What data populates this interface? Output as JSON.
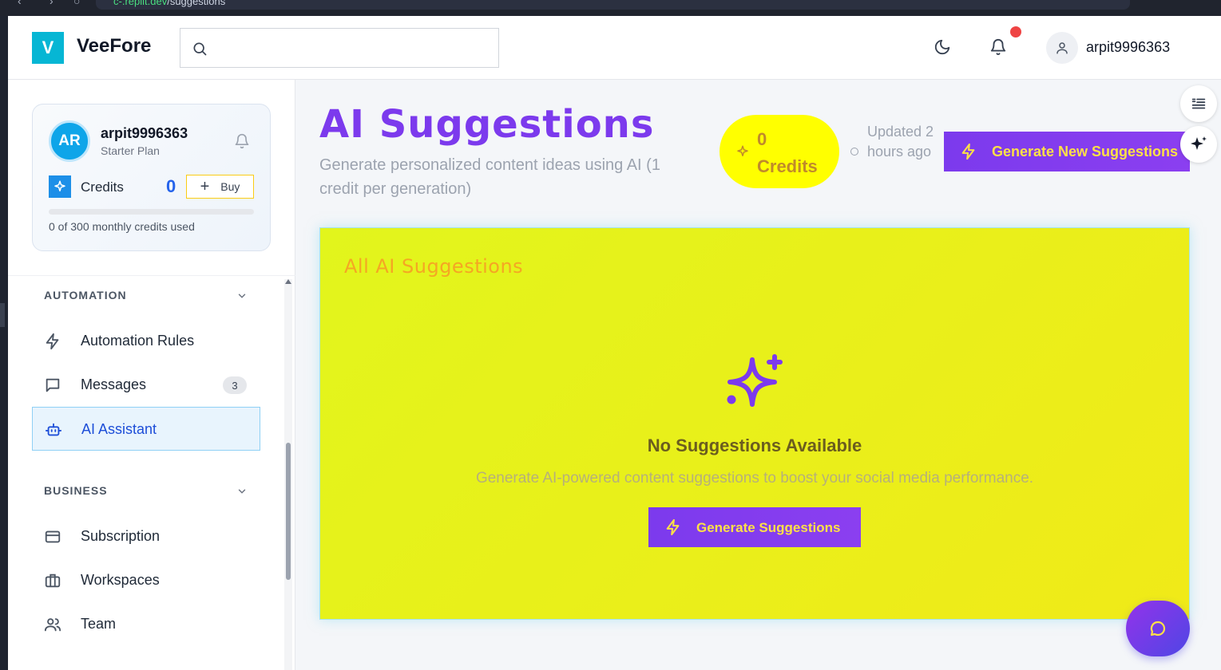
{
  "browser": {
    "url_domain": "c-.replit.dev",
    "url_path": "/suggestions"
  },
  "topbar": {
    "logo_letter": "V",
    "brand": "VeeFore",
    "search_placeholder": "",
    "user_name": "arpit9996363"
  },
  "sidebar": {
    "profile": {
      "initials": "AR",
      "name": "arpit9996363",
      "plan": "Starter Plan",
      "credits_label": "Credits",
      "credits_value": "0",
      "buy_label": "Buy",
      "usage_text": "0 of 300 monthly credits used",
      "usage_fraction": 0
    },
    "sections": [
      {
        "title": "AUTOMATION",
        "items": [
          {
            "label": "Automation Rules",
            "icon": "bolt-icon"
          },
          {
            "label": "Messages",
            "icon": "message-icon",
            "badge": "3"
          },
          {
            "label": "AI Assistant",
            "icon": "robot-icon",
            "active": true
          }
        ]
      },
      {
        "title": "BUSINESS",
        "items": [
          {
            "label": "Subscription",
            "icon": "credit-card-icon"
          },
          {
            "label": "Workspaces",
            "icon": "briefcase-icon"
          },
          {
            "label": "Team",
            "icon": "users-icon"
          }
        ]
      }
    ]
  },
  "main": {
    "title": "AI Suggestions",
    "subtitle": "Generate personalized content ideas using AI (1 credit per generation)",
    "credits_pill": "0 Credits",
    "updated": "Updated 2 hours ago",
    "generate_new_label": "Generate New Suggestions",
    "panel": {
      "title": "All AI Suggestions",
      "empty_title": "No Suggestions Available",
      "empty_desc": "Generate AI-powered content suggestions to boost your social media performance.",
      "button_label": "Generate Suggestions"
    }
  },
  "colors": {
    "accent_purple": "#7c3aed",
    "brand_cyan": "#06b6d4",
    "credits_yellow": "#ffff00",
    "panel_yellow": "#e8f31b",
    "notif_red": "#ef4444"
  }
}
